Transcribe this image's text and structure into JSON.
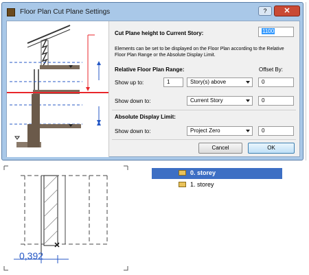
{
  "dialog": {
    "title": "Floor Plan Cut Plane Settings",
    "help_label": "?",
    "close_label": "✕",
    "cut_plane_heading": "Cut Plane height to Current Story:",
    "cut_plane_value": "1100",
    "description": "Elements can be set to be displayed on the Floor Plan according to the Relative Floor Plan Range or the Absolute Display Limit.",
    "relative_heading": "Relative Floor Plan Range:",
    "offset_heading": "Offset By:",
    "show_up_label": "Show up to:",
    "show_up_count": "1",
    "show_up_option": "Story(s) above",
    "show_up_offset": "0",
    "show_down_label": "Show down to:",
    "show_down_option": "Current Story",
    "show_down_offset": "0",
    "absolute_heading": "Absolute Display Limit:",
    "abs_show_down_label": "Show down to:",
    "abs_show_down_option": "Project Zero",
    "abs_show_down_offset": "0",
    "cancel_label": "Cancel",
    "ok_label": "OK"
  },
  "story_tree": {
    "items": [
      {
        "label": "0. storey",
        "selected": true
      },
      {
        "label": "1. storey",
        "selected": false
      }
    ]
  },
  "dimension": {
    "value": "0,392"
  },
  "colors": {
    "accent_red": "#e8262a",
    "dim_blue": "#2457c5",
    "selection_blue": "#3d6fc4"
  }
}
